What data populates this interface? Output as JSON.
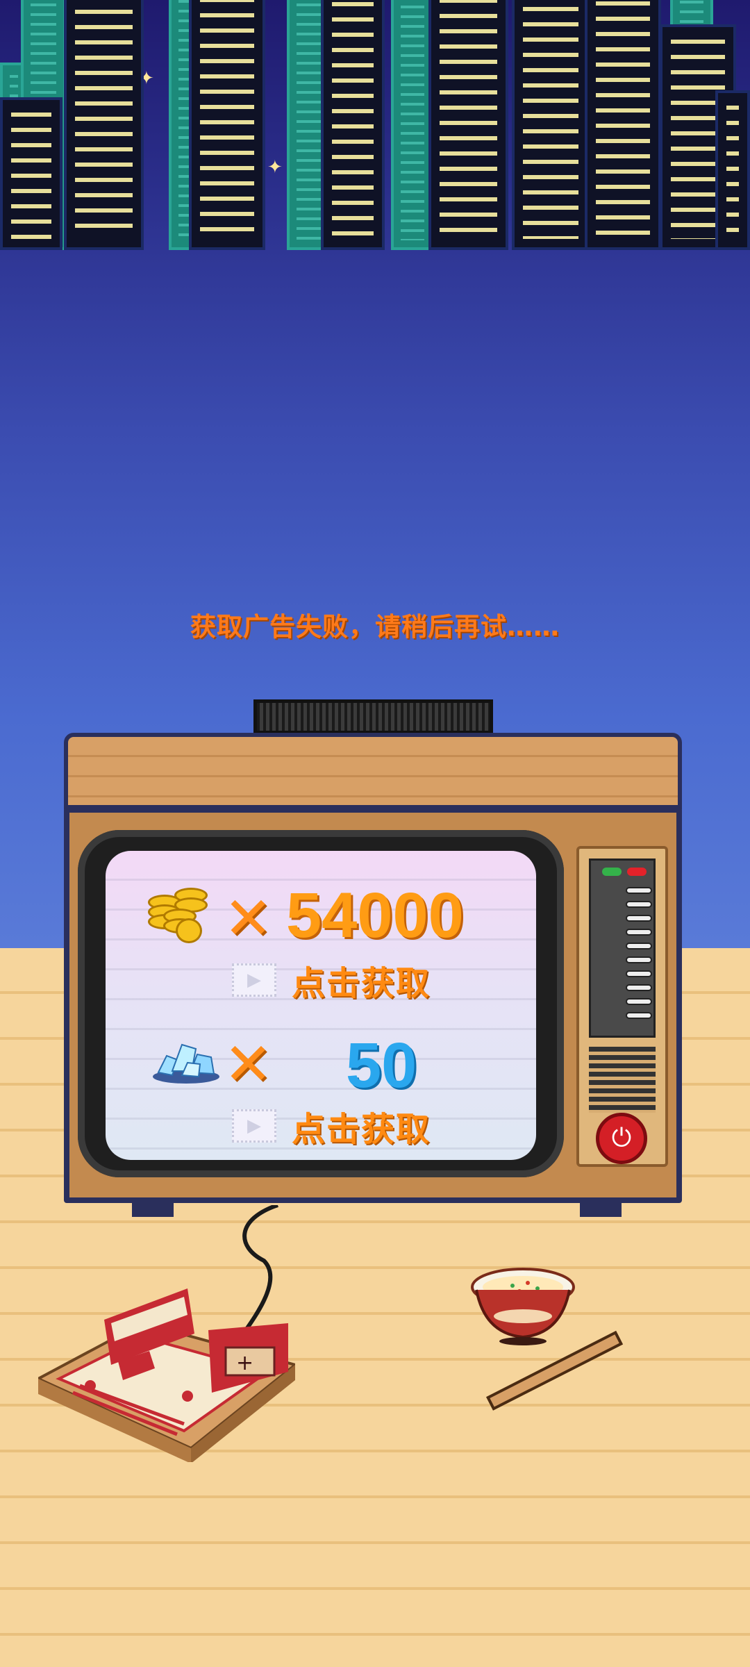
{
  "notice": {
    "text": "获取广告失败，请稍后再试……"
  },
  "rewards": [
    {
      "item": "gold-coins-icon",
      "multiply_sign": "✕",
      "amount": "54000",
      "claim_label": "点击获取"
    },
    {
      "item": "diamond-ice-icon",
      "multiply_sign": "✕",
      "amount": "50",
      "claim_label": "点击获取"
    }
  ],
  "icons": {
    "play": "▶",
    "power": "⏻",
    "star": "✦"
  },
  "colors": {
    "notice": "#ff7a1a",
    "gold_amount": "#ff9c14",
    "blue_amount": "#2aa7ee",
    "claim": "#ff8a12"
  }
}
